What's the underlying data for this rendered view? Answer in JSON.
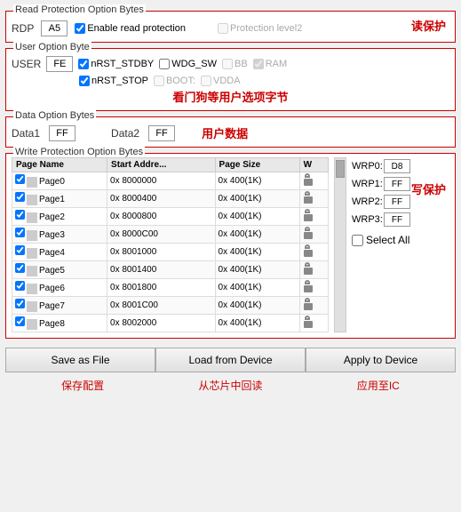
{
  "readProtection": {
    "title": "Read Protection Option Bytes",
    "chinese": "读保护",
    "rdpLabel": "RDP",
    "rdpValue": "A5",
    "enableCheckbox": true,
    "enableLabel": "Enable read protection",
    "protLevel2": "Protection level2",
    "protLevel2Disabled": true
  },
  "userOption": {
    "title": "User Option Byte",
    "chinese": "看门狗等用户选项字节",
    "userLabel": "USER",
    "userValue": "FE",
    "checkboxes": [
      {
        "label": "nRST_STDBY",
        "checked": true
      },
      {
        "label": "WDG_SW",
        "checked": false
      },
      {
        "label": "BB",
        "checked": false,
        "disabled": true
      },
      {
        "label": "RAM",
        "checked": true,
        "disabled": true
      },
      {
        "label": "nRST_STOP",
        "checked": true
      },
      {
        "label": "BOOT:",
        "checked": false,
        "disabled": true
      },
      {
        "label": "VDDA",
        "checked": false,
        "disabled": true
      }
    ]
  },
  "dataOption": {
    "title": "Data Option Bytes",
    "chinese": "用户数据",
    "data1Label": "Data1",
    "data1Value": "FF",
    "data2Label": "Data2",
    "data2Value": "FF"
  },
  "writeProtection": {
    "title": "Write Protection Option Bytes",
    "chinese": "写保护",
    "columns": [
      "Page Name",
      "Start Addre...",
      "Page Size",
      "W"
    ],
    "rows": [
      {
        "name": "Page0",
        "start": "0x 8000000",
        "size": "0x 400(1K)",
        "checked": true
      },
      {
        "name": "Page1",
        "start": "0x 8000400",
        "size": "0x 400(1K)",
        "checked": true
      },
      {
        "name": "Page2",
        "start": "0x 8000800",
        "size": "0x 400(1K)",
        "checked": true
      },
      {
        "name": "Page3",
        "start": "0x 8000C00",
        "size": "0x 400(1K)",
        "checked": true
      },
      {
        "name": "Page4",
        "start": "0x 8001000",
        "size": "0x 400(1K)",
        "checked": true
      },
      {
        "name": "Page5",
        "start": "0x 8001400",
        "size": "0x 400(1K)",
        "checked": true
      },
      {
        "name": "Page6",
        "start": "0x 8001800",
        "size": "0x 400(1K)",
        "checked": true
      },
      {
        "name": "Page7",
        "start": "0x 8001C00",
        "size": "0x 400(1K)",
        "checked": true
      },
      {
        "name": "Page8",
        "start": "0x 8002000",
        "size": "0x 400(1K)",
        "checked": true
      }
    ],
    "wrpLabels": [
      "WRP0:",
      "WRP1:",
      "WRP2:",
      "WRP3:"
    ],
    "wrpValues": [
      "D8",
      "FF",
      "FF",
      "FF"
    ],
    "selectAll": "Select All"
  },
  "buttons": {
    "saveAsFile": "Save as File",
    "loadFromDevice": "Load from Device",
    "applyToDevice": "Apply to Device"
  },
  "annotations": {
    "save": "保存配置",
    "load": "从芯片中回读",
    "apply": "应用至IC"
  }
}
